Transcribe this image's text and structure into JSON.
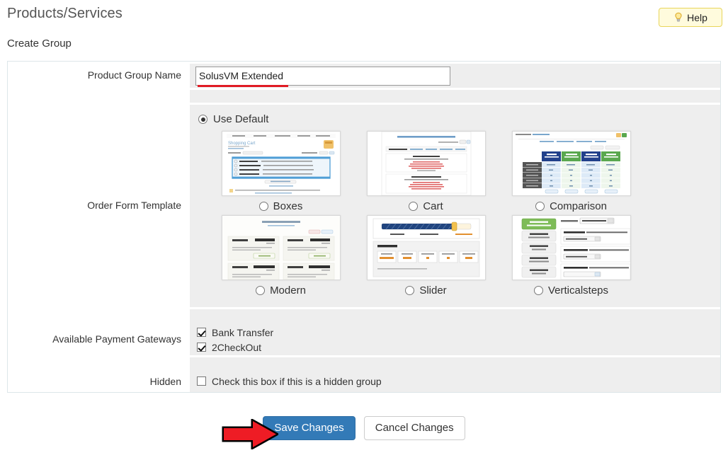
{
  "header": {
    "title": "Products/Services",
    "subtitle": "Create Group",
    "help_label": "Help",
    "help_icon": "lightbulb-icon"
  },
  "form": {
    "group_name": {
      "label": "Product Group Name",
      "value": "SolusVM Extended",
      "placeholder": ""
    },
    "order_form_template": {
      "label": "Order Form Template",
      "use_default_label": "Use Default",
      "use_default_selected": true,
      "options": [
        {
          "label": "Boxes",
          "selected": false,
          "preview": "shopping-cart-page"
        },
        {
          "label": "Cart",
          "selected": false,
          "preview": "browse-products-services-page"
        },
        {
          "label": "Comparison",
          "selected": false,
          "preview": "comparison-pricing-table"
        },
        {
          "label": "Modern",
          "selected": false,
          "preview": "hosting-packages-cards"
        },
        {
          "label": "Slider",
          "selected": false,
          "preview": "package-slider"
        },
        {
          "label": "Verticalsteps",
          "selected": false,
          "preview": "vertical-steps-list"
        }
      ]
    },
    "payment_gateways": {
      "label": "Available Payment Gateways",
      "items": [
        {
          "label": "Bank Transfer",
          "checked": true
        },
        {
          "label": "2CheckOut",
          "checked": true
        }
      ]
    },
    "hidden": {
      "label": "Hidden",
      "checkbox_label": "Check this box if this is a hidden group",
      "checked": false
    }
  },
  "footer": {
    "save_label": "Save Changes",
    "cancel_label": "Cancel Changes"
  },
  "annotations": {
    "arrow_color": "#ee1c25",
    "underline_color": "#e01b24"
  },
  "colors": {
    "accent": "#337ab7",
    "help_bg": "#fffbdd",
    "help_border": "#e8d55a",
    "row_bg": "#eeeeee",
    "panel_border": "#dde6e9"
  }
}
